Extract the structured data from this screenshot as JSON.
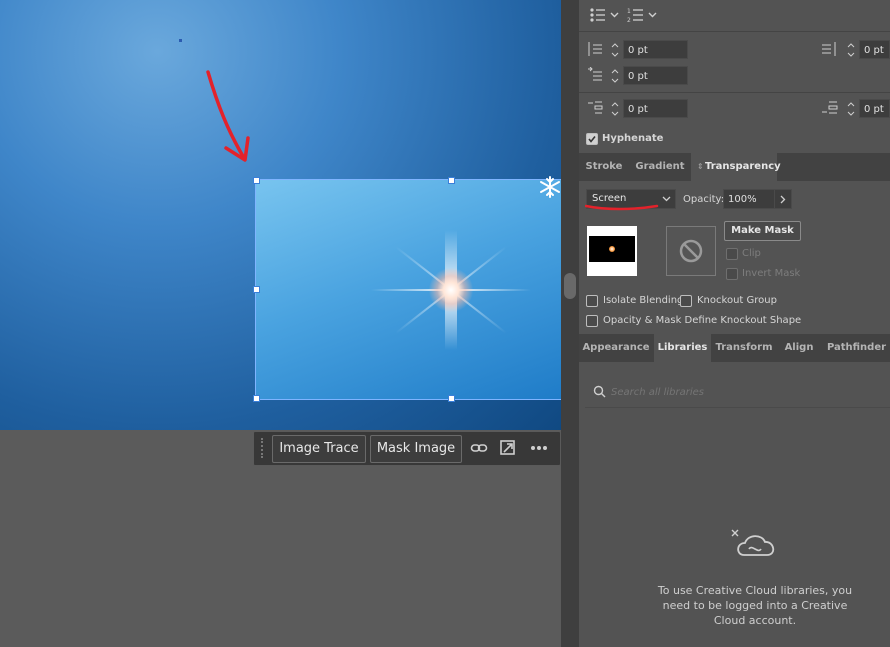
{
  "toolbar": {
    "image_trace_label": "Image Trace",
    "mask_image_label": "Mask Image",
    "icons": [
      "link-icon",
      "transform-icon",
      "more-icon"
    ]
  },
  "paragraph": {
    "left_indent": "0 pt",
    "right_indent": "0 pt",
    "first_line_indent": "0 pt",
    "space_before": "0 pt",
    "space_after": "0 pt",
    "hyphenate_label": "Hyphenate",
    "hyphenate_checked": true
  },
  "tabs_top": {
    "stroke": "Stroke",
    "gradient": "Gradient",
    "transparency": "Transparency",
    "active": "Transparency"
  },
  "transparency": {
    "blend_mode": "Screen",
    "opacity_label": "Opacity:",
    "opacity_value": "100%",
    "make_mask_label": "Make Mask",
    "clip_label": "Clip",
    "invert_mask_label": "Invert Mask",
    "isolate_blending_label": "Isolate Blending",
    "knockout_group_label": "Knockout Group",
    "opacity_mask_define_label": "Opacity & Mask Define Knockout Shape"
  },
  "tabs_bottom": {
    "appearance": "Appearance",
    "libraries": "Libraries",
    "transform": "Transform",
    "align": "Align",
    "pathfinder": "Pathfinder",
    "active": "Libraries"
  },
  "libraries": {
    "search_placeholder": "Search all libraries",
    "message": "To use Creative Cloud libraries, you need to be logged into a Creative Cloud account."
  },
  "colors": {
    "panel_bg": "#535353",
    "annotation_red": "#e3222b",
    "selection_blue": "#3a7fd9"
  }
}
